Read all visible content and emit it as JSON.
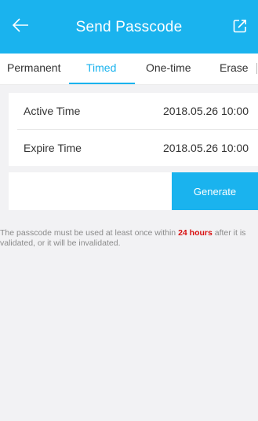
{
  "header": {
    "title": "Send Passcode",
    "back_icon": "arrow-left-icon",
    "share_icon": "share-external-icon",
    "bar_color": "#1ab3ee"
  },
  "tabs": [
    {
      "label": "Permanent",
      "active": false
    },
    {
      "label": "Timed",
      "active": true
    },
    {
      "label": "One-time",
      "active": false
    },
    {
      "label": "Erase",
      "active": false
    }
  ],
  "time_settings": {
    "active_label": "Active Time",
    "active_value": "2018.05.26 10:00",
    "expire_label": "Expire Time",
    "expire_value": "2018.05.26 10:00"
  },
  "generate": {
    "input_value": "",
    "input_placeholder": "",
    "button_label": "Generate"
  },
  "note": {
    "before": "The passcode must be used at least once within ",
    "highlight": "24 hours",
    "after": " after it is validated, or it will be invalidated.",
    "highlight_color": "#d80f0f"
  }
}
